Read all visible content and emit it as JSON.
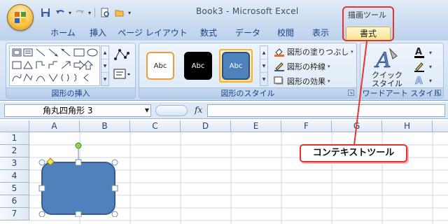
{
  "window": {
    "title": "Book3 - Microsoft Excel"
  },
  "quick_access": {
    "icons": [
      "save-icon",
      "undo-icon",
      "redo-icon",
      "print-preview-icon",
      "open-folder-icon",
      "customize-qat-icon"
    ]
  },
  "contextual_tab_group": {
    "label": "描画ツール"
  },
  "tabs": [
    {
      "label": "ホーム"
    },
    {
      "label": "挿入"
    },
    {
      "label": "ページ レイアウト"
    },
    {
      "label": "数式"
    },
    {
      "label": "データ"
    },
    {
      "label": "校閲"
    },
    {
      "label": "表示"
    },
    {
      "label": "書式",
      "active": true
    }
  ],
  "ribbon": {
    "insert_shapes": {
      "label": "図形の挿入"
    },
    "shape_styles": {
      "label": "図形のスタイル",
      "thumbs": [
        {
          "text": "Abc",
          "fill": "#ffffff",
          "border": "#f29b38",
          "color": "#222222"
        },
        {
          "text": "Abc",
          "fill": "#000000",
          "border": "#000000",
          "color": "#ffffff"
        },
        {
          "text": "Abc",
          "fill": "#4f81bd",
          "border": "#2c4f7c",
          "color": "#ffffff",
          "selected": true
        }
      ],
      "commands": {
        "fill": "図形の塗りつぶし",
        "outline": "図形の枠線",
        "effects": "図形の効果"
      }
    },
    "wordart": {
      "label": "ワードアート スタイル",
      "quick_style_line1": "クイック",
      "quick_style_line2": "スタイル"
    }
  },
  "formula_bar": {
    "name_box": "角丸四角形 3",
    "fx": "fx",
    "formula": ""
  },
  "sheet": {
    "columns": [
      "A",
      "B",
      "C",
      "D",
      "E",
      "F",
      "G",
      "H"
    ],
    "rows": [
      "1",
      "2",
      "3",
      "4",
      "5",
      "6",
      "7"
    ]
  },
  "shape": {
    "fill": "#4f81bd",
    "stroke": "#385d8a"
  },
  "annotation": {
    "text": "コンテキストツール",
    "color": "#e8322e"
  }
}
